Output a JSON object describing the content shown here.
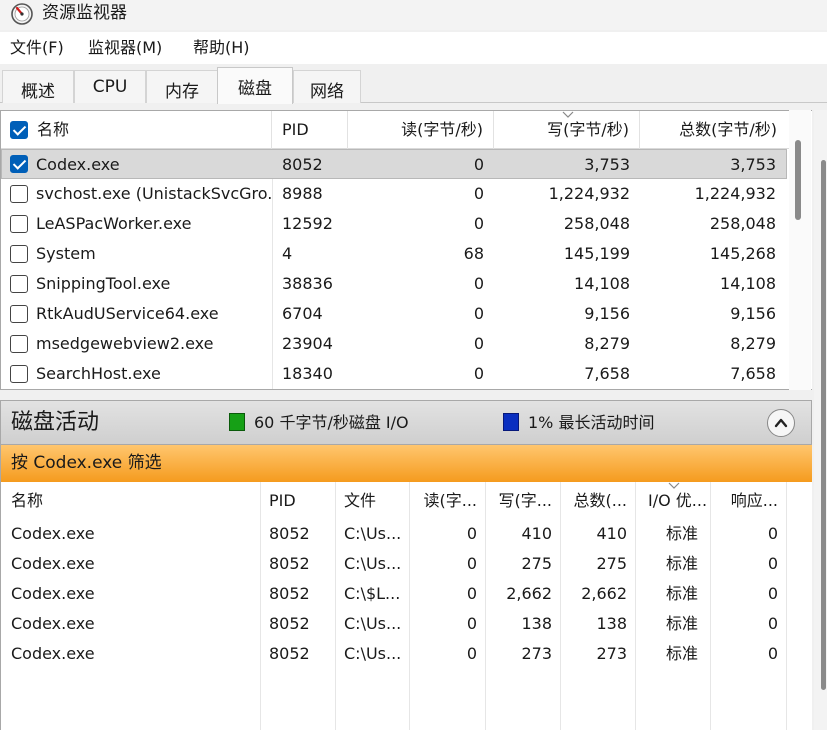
{
  "window": {
    "title": "资源监视器"
  },
  "menu": [
    {
      "label": "文件(F)"
    },
    {
      "label": "监视器(M)"
    },
    {
      "label": "帮助(H)"
    }
  ],
  "tabs": [
    {
      "label": "概述"
    },
    {
      "label": "CPU"
    },
    {
      "label": "内存"
    },
    {
      "label": "磁盘",
      "active": true
    },
    {
      "label": "网络"
    }
  ],
  "processes": {
    "columns": {
      "name": "名称",
      "pid": "PID",
      "read": "读(字节/秒)",
      "write": "写(字节/秒)",
      "total": "总数(字节/秒)"
    },
    "sorted_by": "write",
    "rows": [
      {
        "checked": true,
        "name": "Codex.exe",
        "pid": "8052",
        "read": "0",
        "write": "3,753",
        "total": "3,753"
      },
      {
        "checked": false,
        "name": "svchost.exe (UnistackSvcGro...",
        "pid": "8988",
        "read": "0",
        "write": "1,224,932",
        "total": "1,224,932"
      },
      {
        "checked": false,
        "name": "LeASPacWorker.exe",
        "pid": "12592",
        "read": "0",
        "write": "258,048",
        "total": "258,048"
      },
      {
        "checked": false,
        "name": "System",
        "pid": "4",
        "read": "68",
        "write": "145,199",
        "total": "145,268"
      },
      {
        "checked": false,
        "name": "SnippingTool.exe",
        "pid": "38836",
        "read": "0",
        "write": "14,108",
        "total": "14,108"
      },
      {
        "checked": false,
        "name": "RtkAudUService64.exe",
        "pid": "6704",
        "read": "0",
        "write": "9,156",
        "total": "9,156"
      },
      {
        "checked": false,
        "name": "msedgewebview2.exe",
        "pid": "23904",
        "read": "0",
        "write": "8,279",
        "total": "8,279"
      },
      {
        "checked": false,
        "name": "SearchHost.exe",
        "pid": "18340",
        "read": "0",
        "write": "7,658",
        "total": "7,658"
      }
    ]
  },
  "activity": {
    "title": "磁盘活动",
    "io_text": "60 千字节/秒磁盘 I/O",
    "active_text": "1% 最长活动时间",
    "io_color": "#16a016",
    "active_color": "#0a2fc0"
  },
  "filter": {
    "label": "按 Codex.exe 筛选",
    "color": "#f59b1e"
  },
  "activity_table": {
    "columns": {
      "name": "名称",
      "pid": "PID",
      "file": "文件",
      "read": "读(字...",
      "write": "写(字...",
      "total": "总数(...",
      "priority": "I/O 优...",
      "response": "响应..."
    },
    "rows": [
      {
        "name": "Codex.exe",
        "pid": "8052",
        "file": "C:\\Us...",
        "read": "0",
        "write": "410",
        "total": "410",
        "priority": "标准",
        "response": "0"
      },
      {
        "name": "Codex.exe",
        "pid": "8052",
        "file": "C:\\Us...",
        "read": "0",
        "write": "275",
        "total": "275",
        "priority": "标准",
        "response": "0"
      },
      {
        "name": "Codex.exe",
        "pid": "8052",
        "file": "C:\\$L...",
        "read": "0",
        "write": "2,662",
        "total": "2,662",
        "priority": "标准",
        "response": "0"
      },
      {
        "name": "Codex.exe",
        "pid": "8052",
        "file": "C:\\Us...",
        "read": "0",
        "write": "138",
        "total": "138",
        "priority": "标准",
        "response": "0"
      },
      {
        "name": "Codex.exe",
        "pid": "8052",
        "file": "C:\\Us...",
        "read": "0",
        "write": "273",
        "total": "273",
        "priority": "标准",
        "response": "0"
      }
    ]
  }
}
